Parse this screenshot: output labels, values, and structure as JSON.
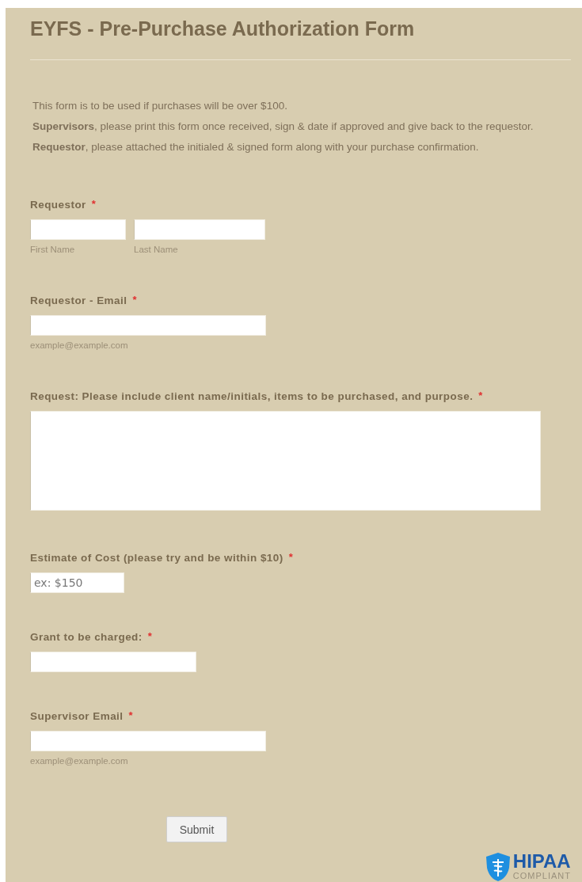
{
  "title": "EYFS - Pre-Purchase Authorization Form",
  "intro": [
    "This form is to be used if purchases will be over $100.",
    "**Supervisors**, please print this form once received, sign & date if approved and give back to the requestor.",
    "**Requestor**, please attached the initialed & signed form along with your purchase confirmation."
  ],
  "fields": [
    {
      "kind": "name",
      "label": "Requestor",
      "asterisk": "*",
      "sublabels": [
        "First Name",
        "Last Name"
      ]
    },
    {
      "kind": "email",
      "label": "Requestor - Email",
      "asterisk": "*",
      "hint": "example@example.com"
    },
    {
      "kind": "textarea",
      "label": "Request: Please include client name/initials, items to be purchased, and purpose.",
      "asterisk": "*"
    },
    {
      "kind": "short",
      "label": "Estimate of Cost (please try and be within $10)",
      "asterisk": "*",
      "placeholder": "ex: $150"
    },
    {
      "kind": "medium",
      "label": "Grant to be charged:",
      "asterisk": "*"
    },
    {
      "kind": "email",
      "label": "Supervisor Email",
      "asterisk": "*",
      "hint": "example@example.com"
    }
  ],
  "submit": "Submit",
  "badge": {
    "title": "HIPAA",
    "subtitle": "COMPLIANT"
  }
}
